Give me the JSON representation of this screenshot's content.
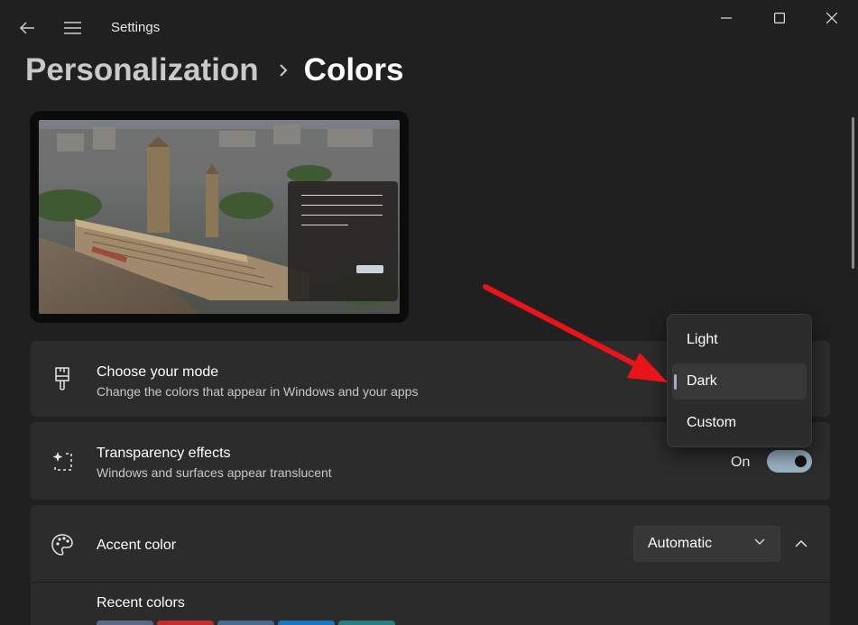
{
  "window": {
    "title": "Settings",
    "back_icon": "back-arrow-icon",
    "menu_icon": "hamburger-menu-icon",
    "controls": [
      "minimize-icon",
      "maximize-icon",
      "close-icon"
    ]
  },
  "breadcrumb": {
    "parent": "Personalization",
    "separator_icon": "chevron-right-icon",
    "current": "Colors"
  },
  "preview": {
    "background": "aerial photo of Houses of Parliament, London"
  },
  "mode_card": {
    "icon": "paintbrush-icon",
    "title": "Choose your mode",
    "description": "Change the colors that appear in Windows and your apps"
  },
  "mode_menu": {
    "items": [
      {
        "label": "Light",
        "selected": false
      },
      {
        "label": "Dark",
        "selected": true
      },
      {
        "label": "Custom",
        "selected": false
      }
    ]
  },
  "transparency_card": {
    "icon": "sparkle-square-icon",
    "title": "Transparency effects",
    "description": "Windows and surfaces appear translucent",
    "toggle_label": "On",
    "toggle_on": true
  },
  "accent_card": {
    "icon": "palette-icon",
    "title": "Accent color",
    "select_value": "Automatic",
    "expand_icon": "chevron-up-icon"
  },
  "recent_colors": {
    "label": "Recent colors",
    "swatches": [
      "#5a6a86",
      "#c42b2b",
      "#4a6a8e",
      "#1b76c0",
      "#2a7d80"
    ]
  },
  "colors": {
    "background": "#202020",
    "card": "#2c2c2c",
    "accent": "#9ab2c4",
    "annotation_arrow": "#e8141a"
  }
}
